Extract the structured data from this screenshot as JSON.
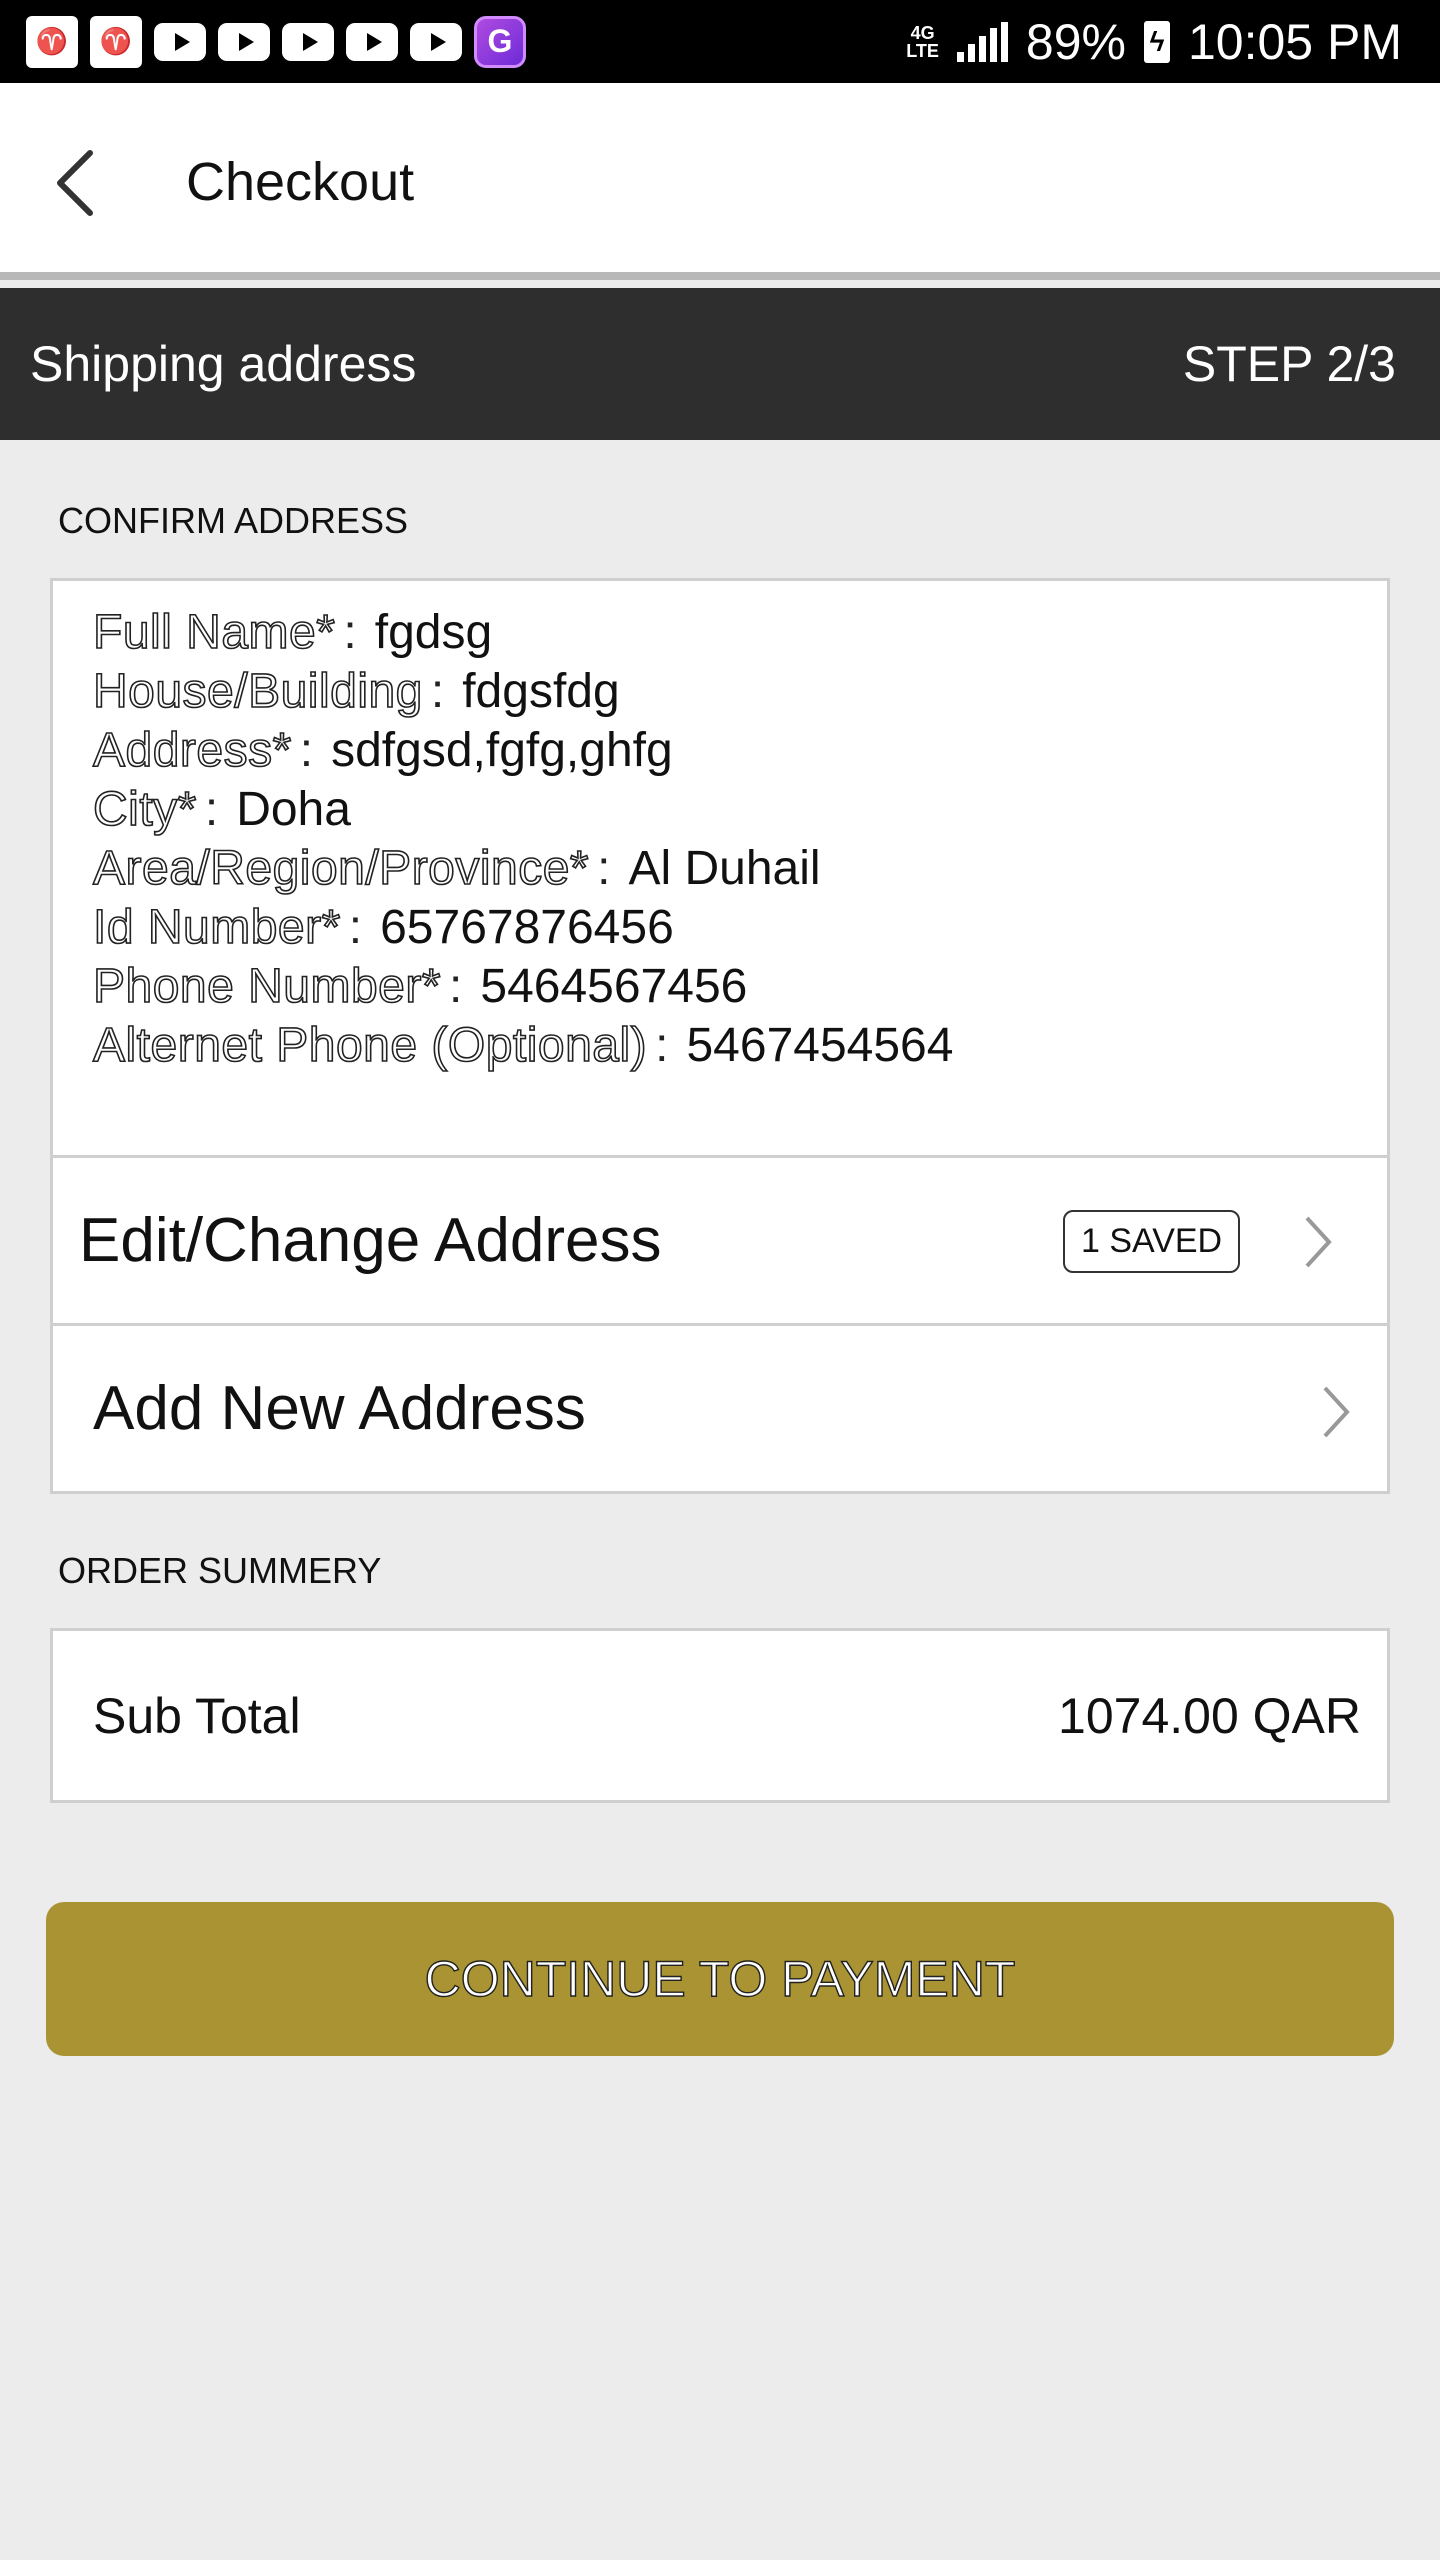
{
  "status_bar": {
    "apps": [
      "app-logo-icon",
      "app-logo-icon",
      "youtube-icon",
      "youtube-icon",
      "youtube-icon",
      "youtube-icon",
      "youtube-icon",
      "g-app-icon"
    ],
    "network": "4G LTE",
    "battery": "89%",
    "time": "10:05 PM"
  },
  "header": {
    "title": "Checkout"
  },
  "step": {
    "title": "Shipping address",
    "indicator": "STEP 2/3"
  },
  "confirm_address": {
    "section_label": "CONFIRM ADDRESS",
    "fields": [
      {
        "label": "Full Name*",
        "value": "fgdsg"
      },
      {
        "label": "House/Building",
        "value": "fdgsfdg"
      },
      {
        "label": "Address*",
        "value": "sdfgsd,fgfg,ghfg"
      },
      {
        "label": "City*",
        "value": "Doha"
      },
      {
        "label": "Area/Region/Province*",
        "value": "Al Duhail"
      },
      {
        "label": "Id Number*",
        "value": "65767876456"
      },
      {
        "label": "Phone Number*",
        "value": "5464567456"
      },
      {
        "label": "Alternet Phone (Optional)",
        "value": "5467454564"
      }
    ],
    "separator": ":",
    "edit_label": "Edit/Change Address",
    "saved_badge": "1 SAVED",
    "add_label": "Add New Address"
  },
  "order_summary": {
    "section_label": "ORDER SUMMERY",
    "subtotal_label": "Sub Total",
    "subtotal_value": "1074.00 QAR"
  },
  "cta": {
    "label": "CONTINUE TO PAYMENT",
    "color": "#a99332"
  }
}
